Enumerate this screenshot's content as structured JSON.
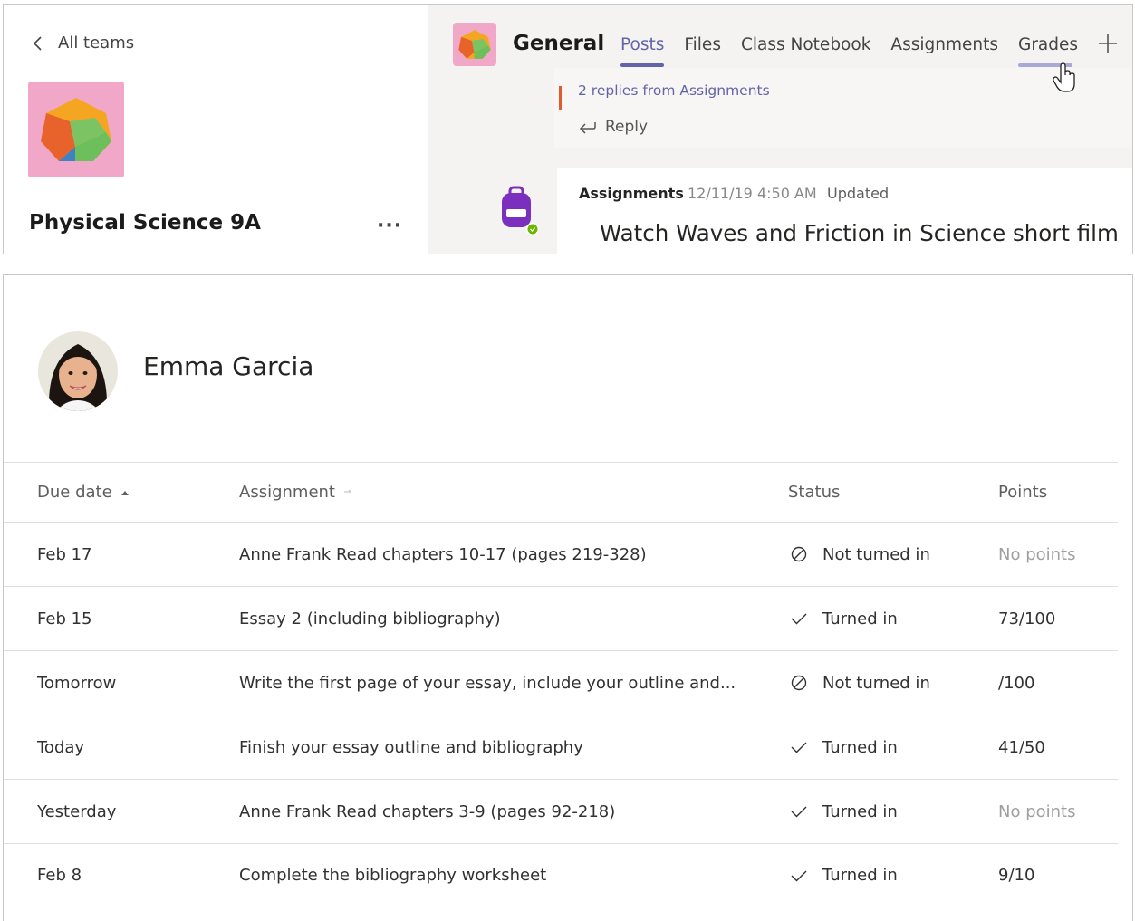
{
  "team_panel": {
    "back_label": "All teams",
    "team_name": "Physical Science 9A",
    "more_label": "···"
  },
  "channel": {
    "name": "General",
    "tabs": [
      {
        "label": "Posts",
        "state": "active"
      },
      {
        "label": "Files",
        "state": "normal"
      },
      {
        "label": "Class Notebook",
        "state": "normal"
      },
      {
        "label": "Assignments",
        "state": "normal"
      },
      {
        "label": "Grades",
        "state": "hover"
      }
    ]
  },
  "feed": {
    "replies_link": "2 replies from Assignments",
    "reply_label": "Reply",
    "message": {
      "sender": "Assignments",
      "timestamp": "12/11/19 4:50 AM",
      "updated_label": "Updated",
      "title": "Watch Waves and Friction in Science short film"
    }
  },
  "student": {
    "name": "Emma Garcia"
  },
  "grades_table": {
    "headers": {
      "due_date": "Due date",
      "assignment": "Assignment",
      "status": "Status",
      "points": "Points"
    },
    "rows": [
      {
        "due": "Feb 17",
        "assignment": "Anne Frank Read chapters 10-17 (pages 219-328)",
        "status": "Not turned in",
        "status_icon": "not-turned-in-icon",
        "points": "No points",
        "points_muted": true
      },
      {
        "due": "Feb 15",
        "assignment": "Essay 2 (including bibliography)",
        "status": "Turned in",
        "status_icon": "checkmark-icon",
        "points": "73/100",
        "points_muted": false
      },
      {
        "due": "Tomorrow",
        "assignment": "Write the first page of your essay, include your outline and...",
        "status": "Not turned in",
        "status_icon": "not-turned-in-icon",
        "points": "/100",
        "points_muted": false
      },
      {
        "due": "Today",
        "assignment": "Finish your essay outline and bibliography",
        "status": "Turned in",
        "status_icon": "checkmark-icon",
        "points": "41/50",
        "points_muted": false
      },
      {
        "due": "Yesterday",
        "assignment": "Anne Frank Read chapters 3-9 (pages 92-218)",
        "status": "Turned in",
        "status_icon": "checkmark-icon",
        "points": "No points",
        "points_muted": true
      },
      {
        "due": "Feb 8",
        "assignment": "Complete the bibliography worksheet",
        "status": "Turned in",
        "status_icon": "checkmark-icon",
        "points": "9/10",
        "points_muted": false
      }
    ]
  },
  "colors": {
    "accent": "#6264a7",
    "team_logo_bg": "#f1a8c8",
    "reply_bar": "#e05b2e",
    "presence_available": "#6bb700",
    "bot_avatar": "#7b2fbe"
  }
}
